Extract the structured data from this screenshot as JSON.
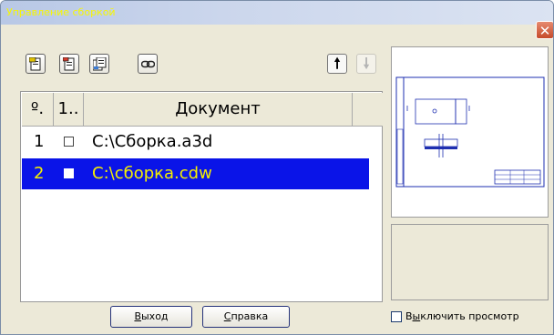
{
  "window": {
    "title": "Управление сборкой"
  },
  "toolbar": {
    "buttons": [
      {
        "icon": "document-export-icon"
      },
      {
        "icon": "document-add-icon"
      },
      {
        "icon": "documents-copy-icon"
      },
      {
        "icon": "chain-link-icon"
      }
    ],
    "move_up_icon": "arrow-up-icon",
    "move_down_icon": "arrow-down-icon"
  },
  "table": {
    "headers": [
      "º.",
      "1..",
      "Документ"
    ],
    "rows": [
      {
        "num": "1",
        "checked": false,
        "document": "C:\\Сборка.a3d",
        "selected": false
      },
      {
        "num": "2",
        "checked": true,
        "document": "C:\\сборка.cdw",
        "selected": true
      }
    ]
  },
  "buttons": {
    "exit_prefix": "В",
    "exit_rest": "ыход",
    "help_prefix": "С",
    "help_rest": "правка"
  },
  "preview_toggle": {
    "label_prefix": "В",
    "label_underlined": "ы",
    "label_rest": "ключить просмотр",
    "checked": false
  },
  "colors": {
    "selection": "#0a14e8",
    "selection_text": "#f6f000",
    "title_text": "#f7f700"
  }
}
